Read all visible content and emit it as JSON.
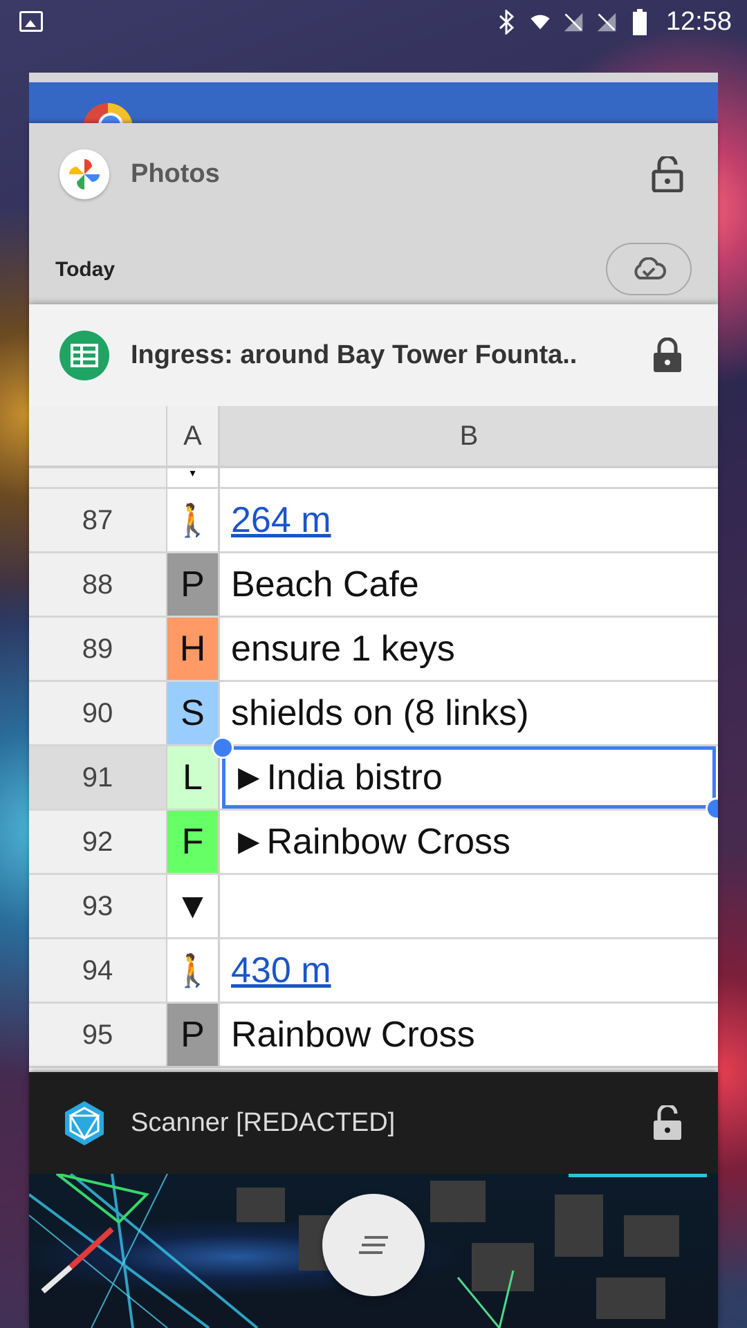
{
  "status_bar": {
    "time": "12:58",
    "icons": [
      "image-icon",
      "bluetooth-icon",
      "wifi-icon",
      "no-signal-icon",
      "no-signal-icon",
      "battery-icon"
    ]
  },
  "recents": {
    "photos": {
      "title": "Photos",
      "section_label": "Today"
    },
    "sheets": {
      "title": "Ingress: around Bay Tower Founta..",
      "columns": [
        "A",
        "B"
      ],
      "partial_row_marker": "▾",
      "rows": [
        {
          "num": "87",
          "a": "🚶",
          "b": "264 m",
          "a_color": "#ffffff",
          "b_link": true
        },
        {
          "num": "88",
          "a": "P",
          "b": "Beach Cafe",
          "a_color": "#999999",
          "b_link": false
        },
        {
          "num": "89",
          "a": "H",
          "b": "ensure 1 keys",
          "a_color": "#ff9966",
          "b_link": false
        },
        {
          "num": "90",
          "a": "S",
          "b": "shields on (8 links)",
          "a_color": "#99ccff",
          "b_link": false
        },
        {
          "num": "91",
          "a": "L",
          "b": "►India bistro",
          "a_color": "#ccffcc",
          "b_link": false,
          "selected": true
        },
        {
          "num": "92",
          "a": "F",
          "b": "►Rainbow Cross",
          "a_color": "#66ff66",
          "b_link": false
        },
        {
          "num": "93",
          "a": "▼",
          "b": "",
          "a_color": "#ffffff",
          "b_link": false
        },
        {
          "num": "94",
          "a": "🚶",
          "b": "430 m",
          "a_color": "#ffffff",
          "b_link": true
        },
        {
          "num": "95",
          "a": "P",
          "b": "Rainbow Cross",
          "a_color": "#999999",
          "b_link": false
        }
      ]
    },
    "scanner": {
      "title": "Scanner [REDACTED]"
    }
  },
  "colors": {
    "sheets_green": "#1fa463",
    "selection_blue": "#3d7ef0",
    "chrome_blue": "#3568c4",
    "link_blue": "#1a55c8"
  }
}
